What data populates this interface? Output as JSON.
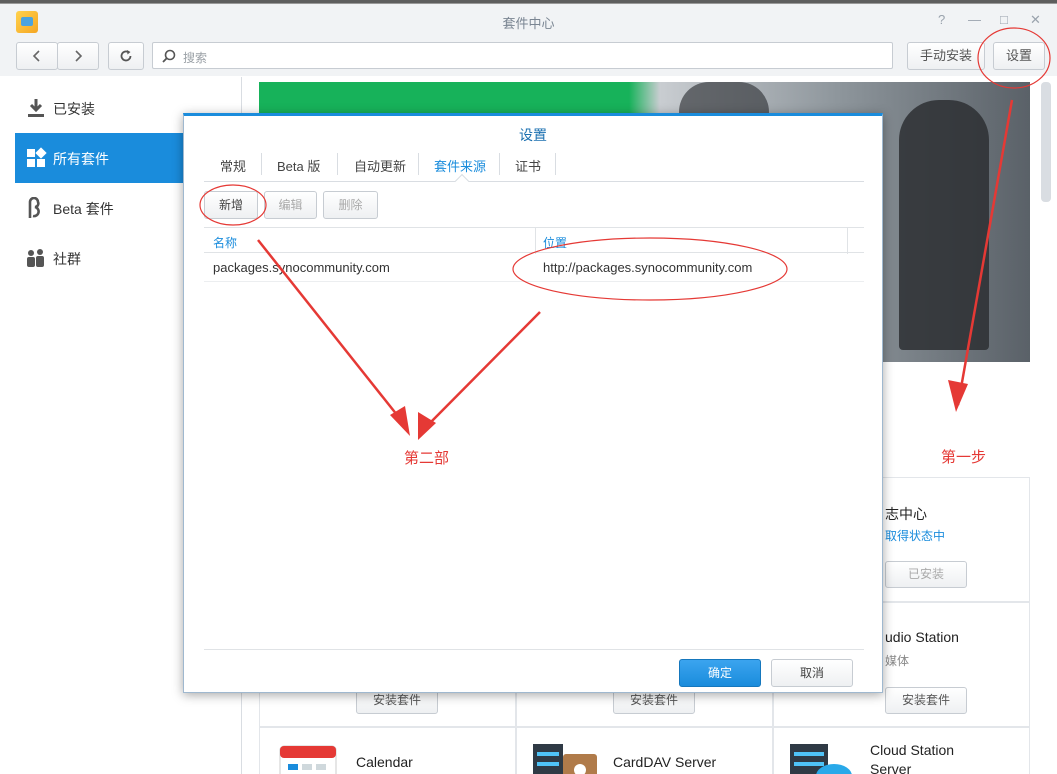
{
  "window": {
    "title": "套件中心",
    "controls": [
      "?",
      "—",
      "□",
      "✕"
    ]
  },
  "toolbar": {
    "search_placeholder": "搜索",
    "manual_install": "手动安装",
    "settings": "设置"
  },
  "sidebar": {
    "items": [
      {
        "label": "已安装",
        "icon": "download-icon"
      },
      {
        "label": "所有套件",
        "icon": "grid-icon",
        "active": true
      },
      {
        "label": "Beta 套件",
        "icon": "beta-icon"
      },
      {
        "label": "社群",
        "icon": "community-icon"
      }
    ]
  },
  "packages": [
    {
      "name": "志中心",
      "status": "取得状态中",
      "button": "已安装"
    },
    {
      "name": "udio Station",
      "category": "媒体",
      "button": "安装套件"
    },
    {
      "button": "安装套件"
    },
    {
      "button": "安装套件"
    },
    {
      "name": "Calendar"
    },
    {
      "name": "CardDAV Server"
    },
    {
      "name": "Cloud Station",
      "name2": "Server"
    }
  ],
  "dialog": {
    "title": "设置",
    "tabs": [
      "常规",
      "Beta 版",
      "自动更新",
      "套件来源",
      "证书"
    ],
    "active_tab": "套件来源",
    "buttons": {
      "add": "新增",
      "edit": "编辑",
      "delete": "删除"
    },
    "columns": [
      "名称",
      "位置"
    ],
    "rows": [
      {
        "name": "packages.synocommunity.com",
        "location": "http://packages.synocommunity.com"
      }
    ],
    "ok": "确定",
    "cancel": "取消"
  },
  "annotations": {
    "step1": "第一步",
    "step2": "第二部",
    "color": "#e53935"
  }
}
